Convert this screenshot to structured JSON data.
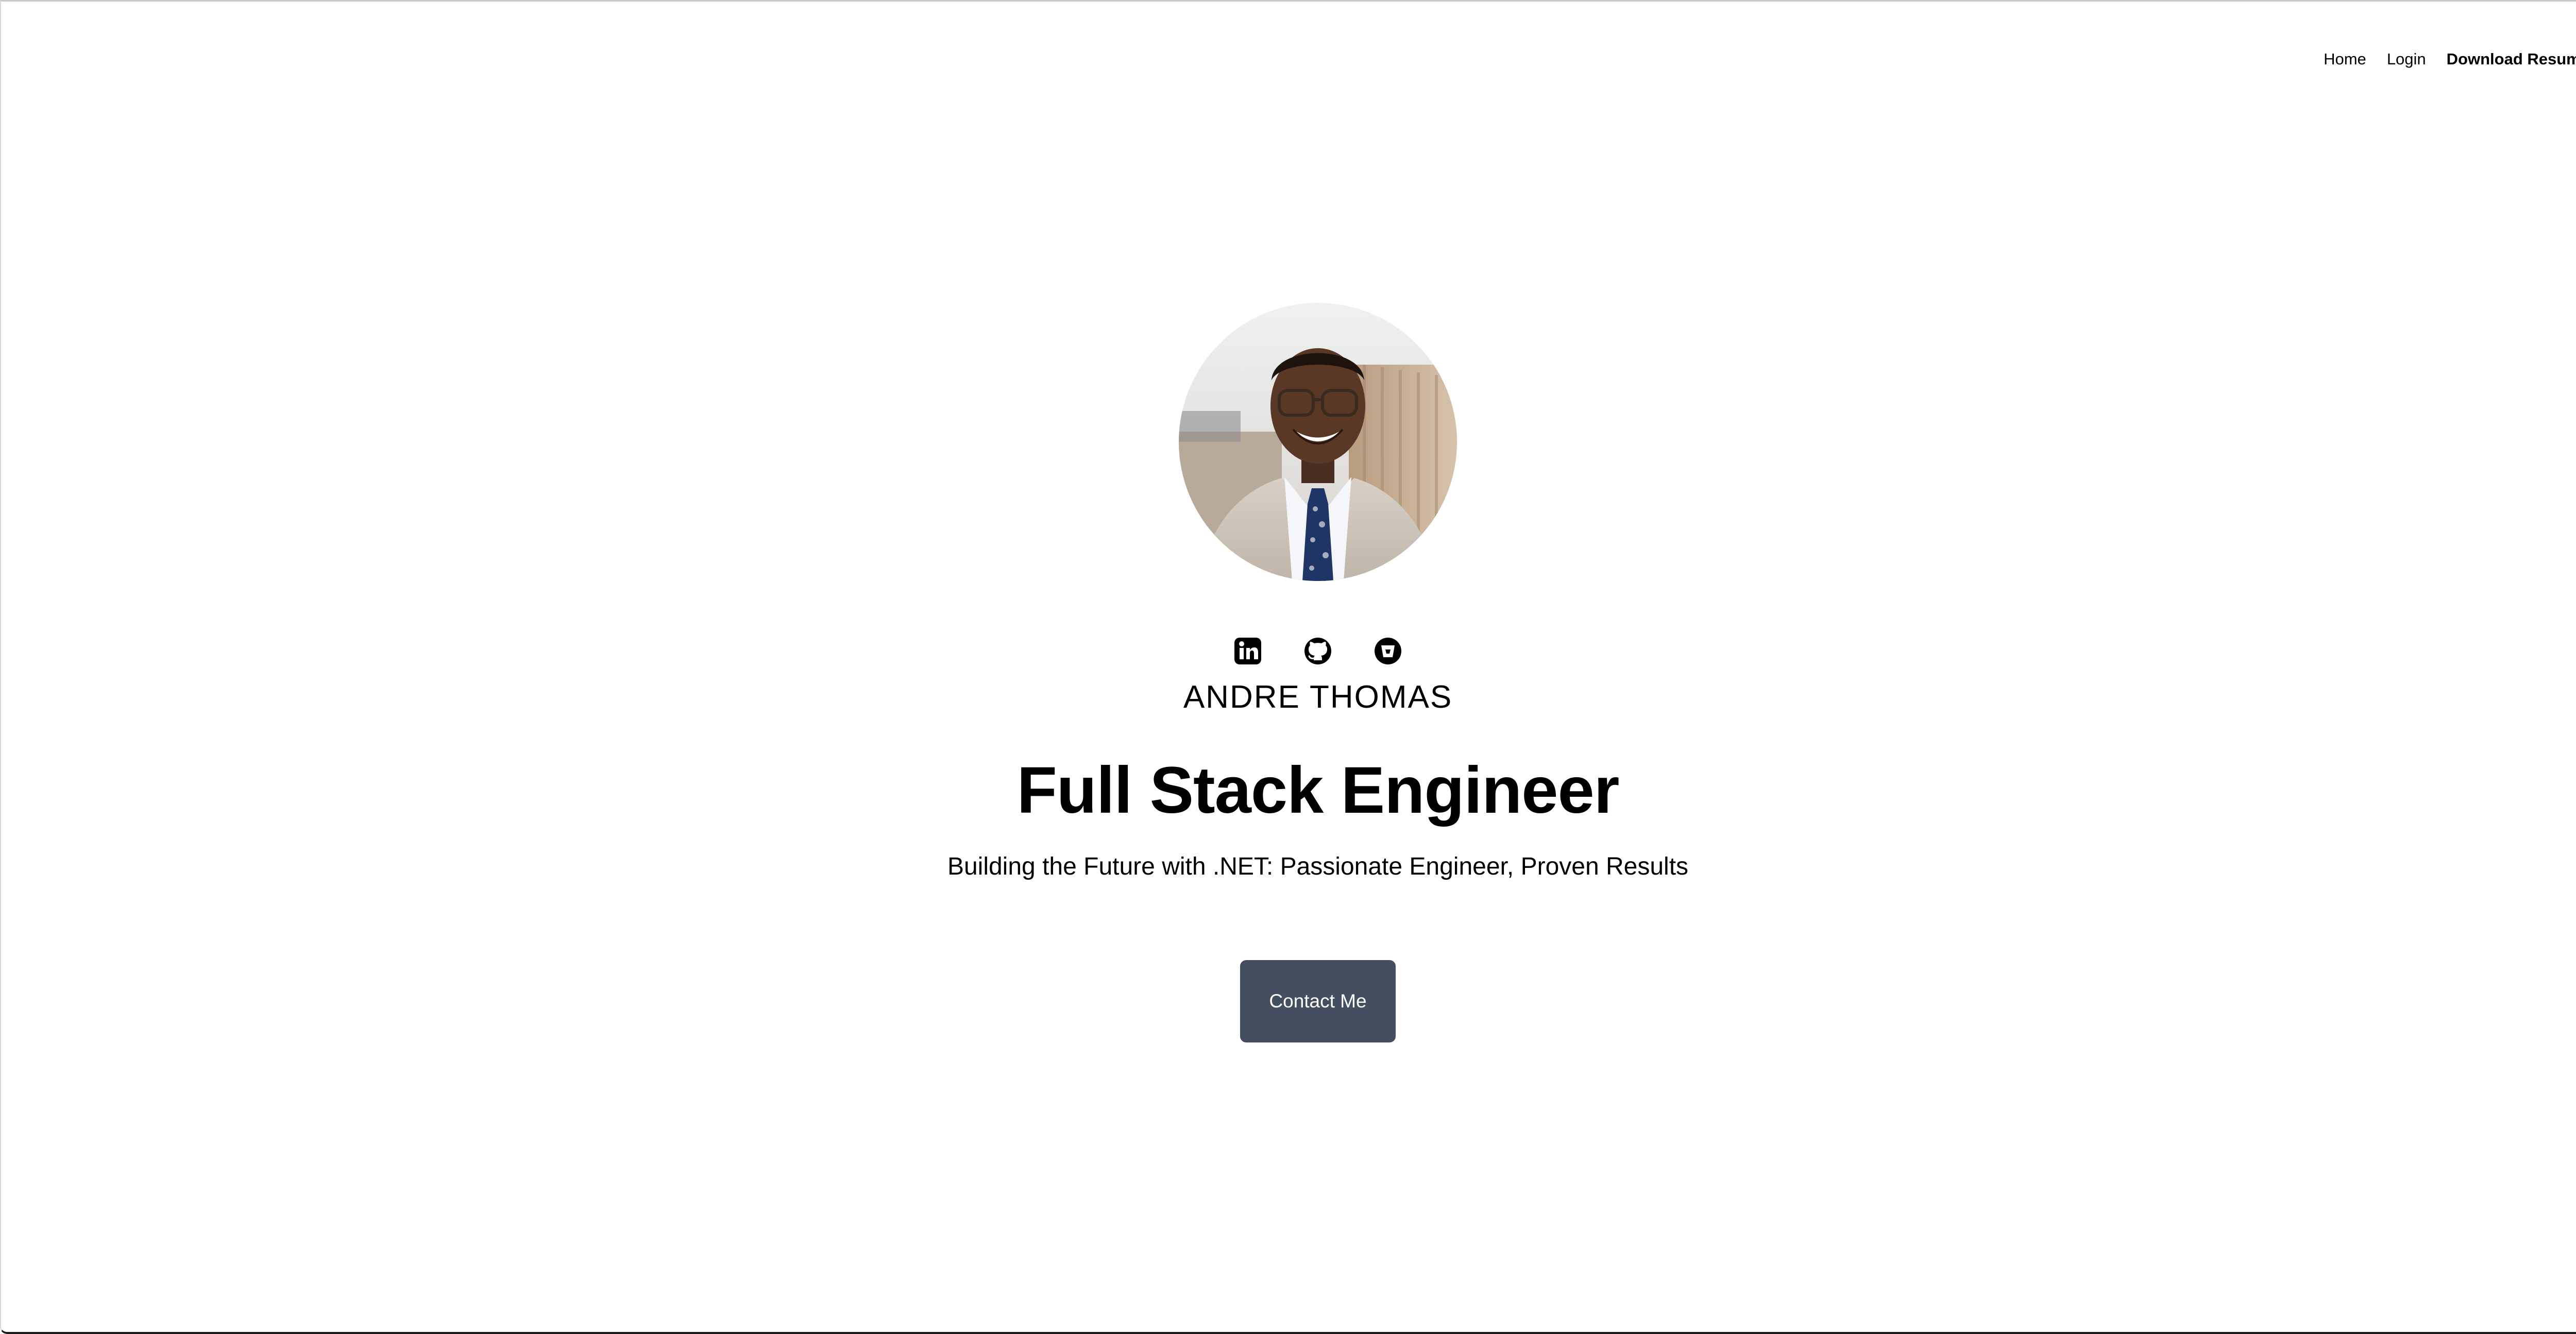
{
  "nav": {
    "home": "Home",
    "login": "Login",
    "download_resume": "Download Resume"
  },
  "profile": {
    "name": "ANDRE THOMAS",
    "title": "Full Stack Engineer",
    "tagline": "Building the Future with .NET: Passionate Engineer, Proven Results",
    "photo": "portrait-photo"
  },
  "social": [
    {
      "icon": "linkedin-icon"
    },
    {
      "icon": "github-icon"
    },
    {
      "icon": "bitbucket-icon"
    }
  ],
  "cta": {
    "contact_label": "Contact Me"
  },
  "colors": {
    "background": "#ffffff",
    "text": "#000000",
    "button_bg": "#434e60",
    "button_text": "#ffffff"
  }
}
